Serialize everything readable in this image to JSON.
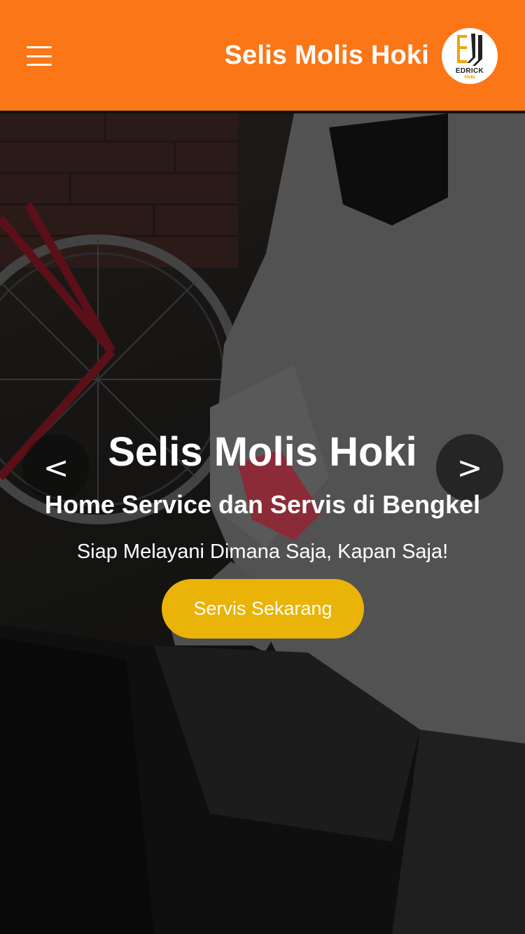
{
  "header": {
    "brand": "Selis Molis Hoki",
    "logo": {
      "name": "EDRICK",
      "sub": "Hoki"
    },
    "colors": {
      "bar": "#fb7616"
    }
  },
  "hero": {
    "title": "Selis Molis Hoki",
    "subtitle": "Home Service dan Servis di Bengkel",
    "tagline": "Siap Melayani Dimana Saja, Kapan Saja!",
    "cta_label": "Servis Sekarang",
    "prev_label": "<",
    "next_label": ">",
    "colors": {
      "cta": "#eab308"
    }
  },
  "icons": [
    "menu-icon",
    "logo-icon"
  ]
}
